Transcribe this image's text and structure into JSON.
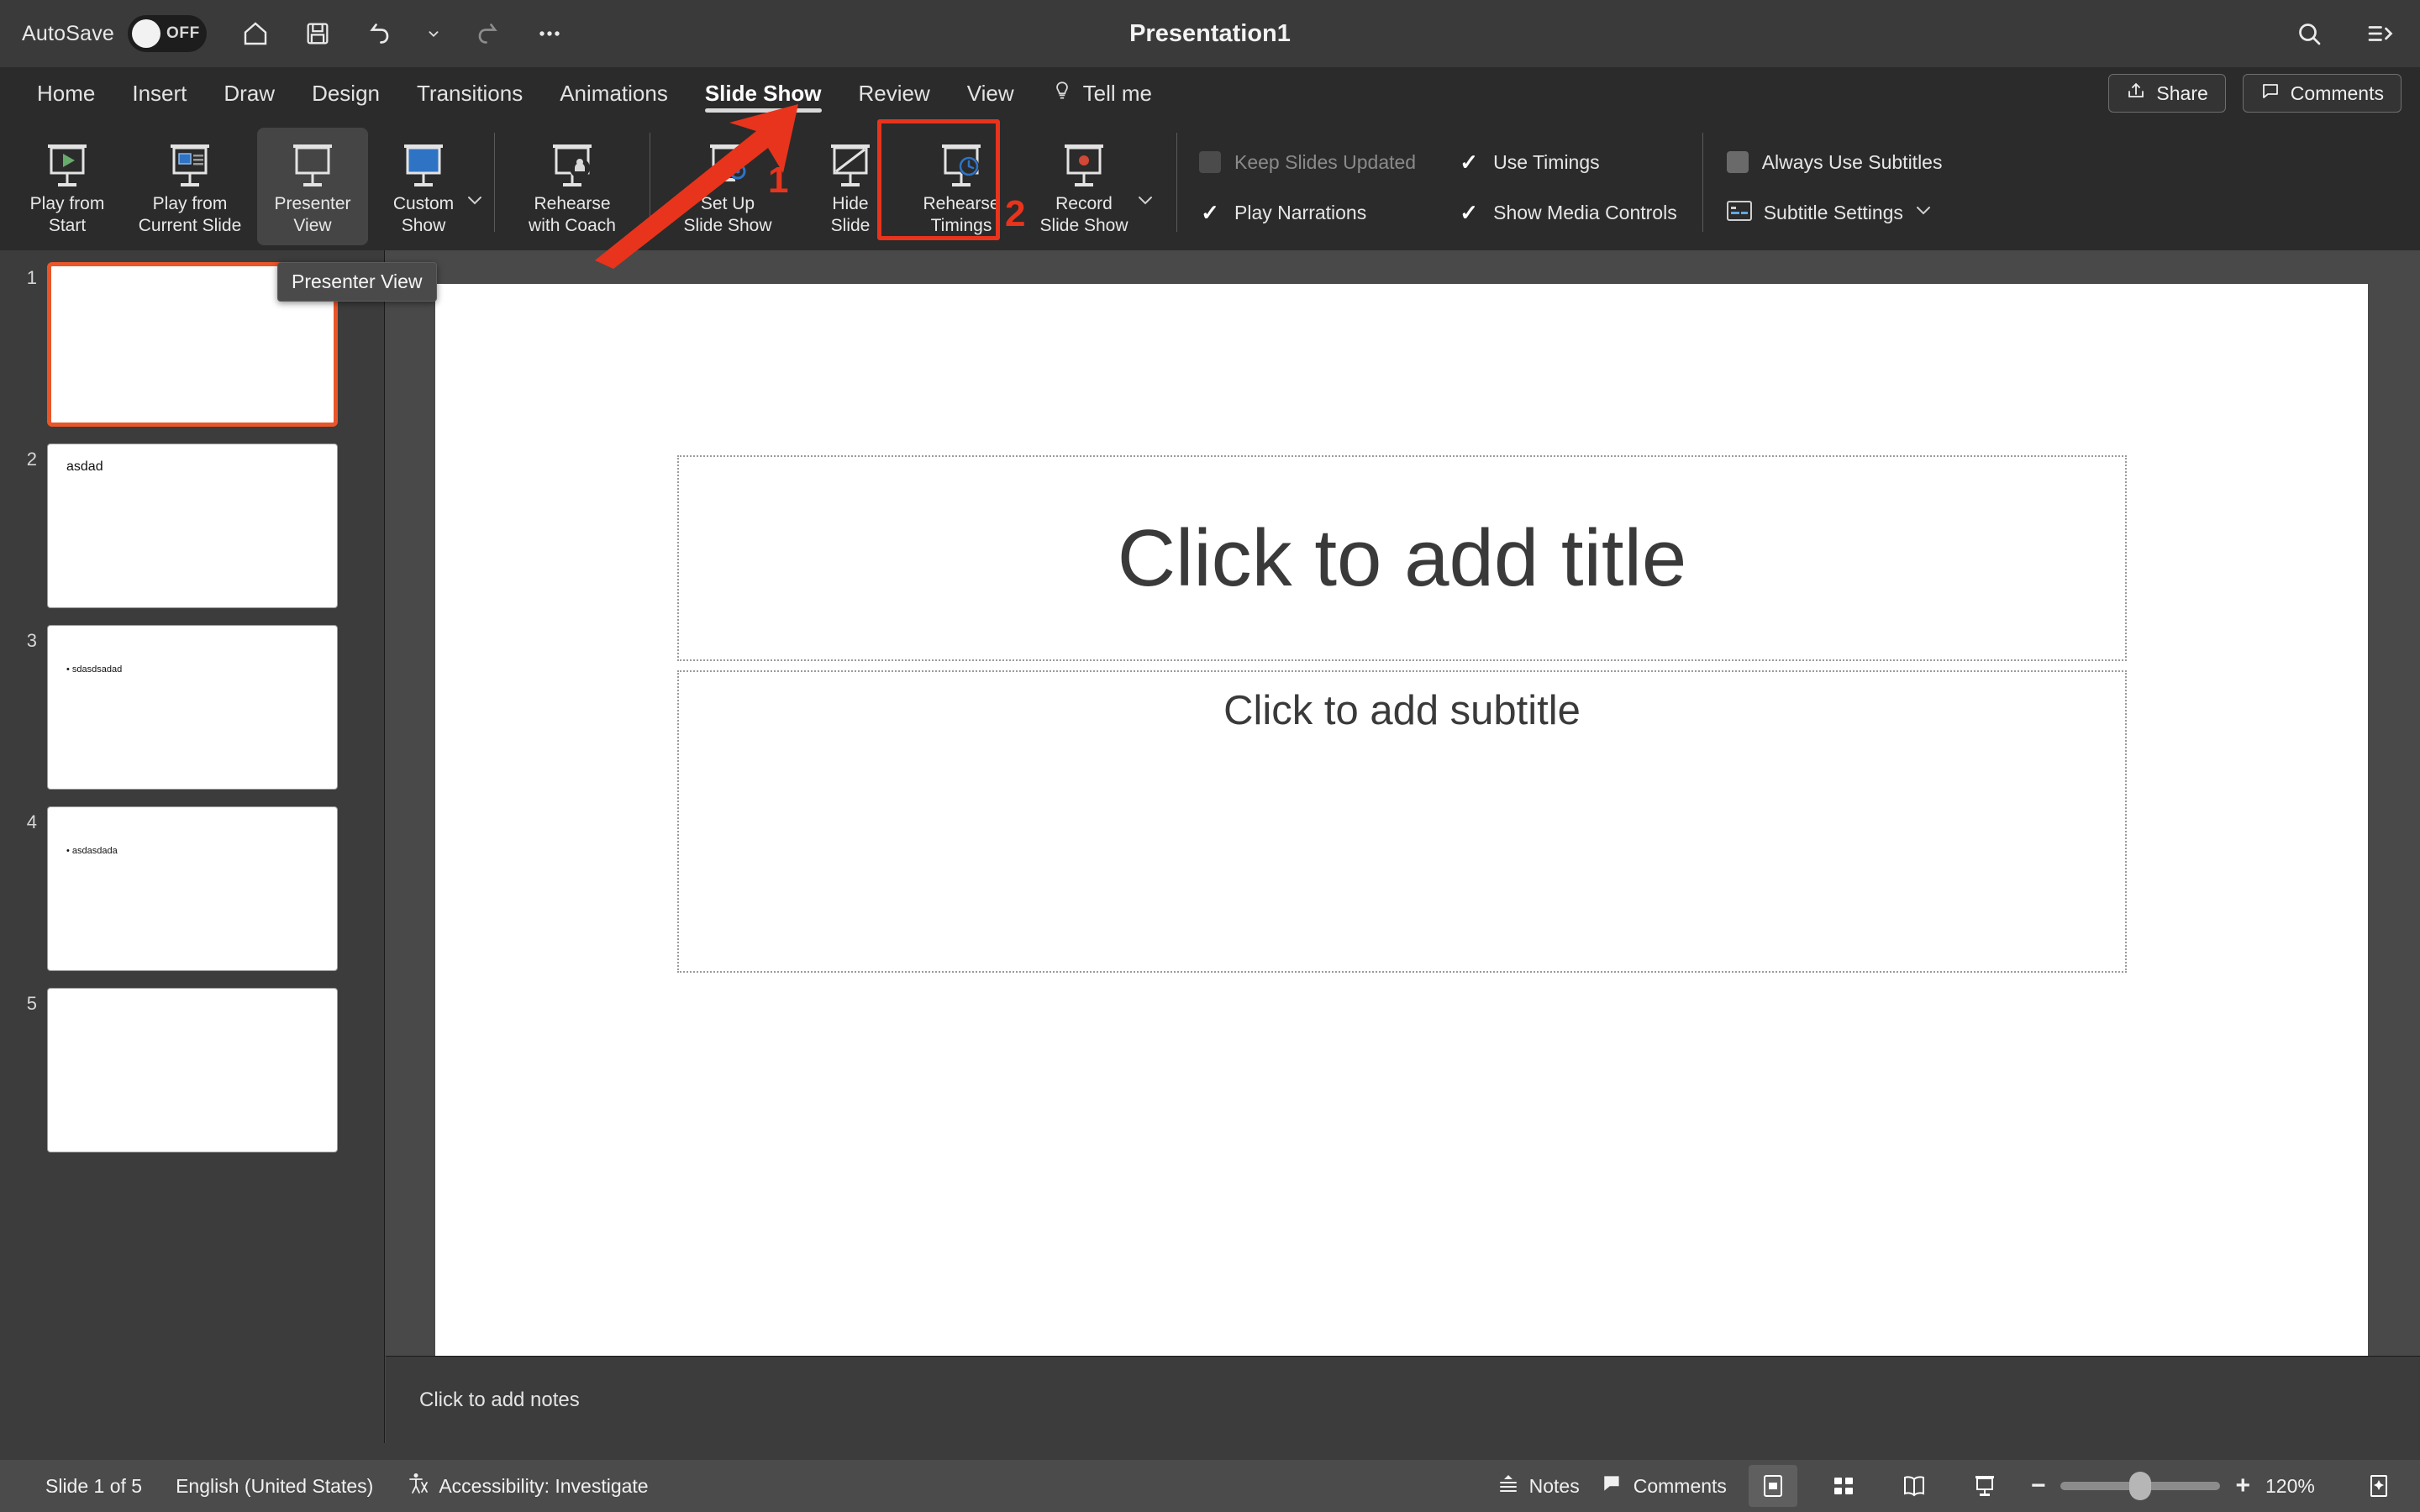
{
  "titlebar": {
    "autosave_label": "AutoSave",
    "autosave_state": "OFF",
    "document_title": "Presentation1",
    "icons": [
      "home-icon",
      "save-icon",
      "undo-icon",
      "undo-dropdown-icon",
      "redo-icon",
      "more-options-icon"
    ],
    "right_icons": [
      "search-icon",
      "ribbon-display-icon"
    ]
  },
  "tabs": [
    {
      "label": "Home",
      "active": false
    },
    {
      "label": "Insert",
      "active": false
    },
    {
      "label": "Draw",
      "active": false
    },
    {
      "label": "Design",
      "active": false
    },
    {
      "label": "Transitions",
      "active": false
    },
    {
      "label": "Animations",
      "active": false
    },
    {
      "label": "Slide Show",
      "active": true
    },
    {
      "label": "Review",
      "active": false
    },
    {
      "label": "View",
      "active": false
    }
  ],
  "tellme": {
    "label": "Tell me",
    "icon": "lightbulb-icon"
  },
  "tabbar_right": {
    "share_label": "Share",
    "share_icon": "share-icon",
    "comments_label": "Comments",
    "comments_icon": "comment-icon"
  },
  "ribbon": {
    "buttons": [
      {
        "label": "Play from\nStart",
        "line1": "Play from",
        "line2": "Start",
        "icon": "play-from-start-icon"
      },
      {
        "label": "Play from\nCurrent Slide",
        "line1": "Play from",
        "line2": "Current Slide",
        "icon": "play-from-current-slide-icon"
      },
      {
        "label": "Presenter\nView",
        "line1": "Presenter",
        "line2": "View",
        "icon": "presenter-view-icon",
        "hovered": true
      },
      {
        "label": "Custom\nShow",
        "line1": "Custom",
        "line2": "Show",
        "icon": "custom-show-icon",
        "has_dropdown": true
      },
      {
        "label": "Rehearse\nwith Coach",
        "line1": "Rehearse",
        "line2": "with Coach",
        "icon": "rehearse-with-coach-icon"
      },
      {
        "label": "Set Up\nSlide Show",
        "line1": "Set Up",
        "line2": "Slide Show",
        "icon": "set-up-slide-show-icon"
      },
      {
        "label": "Hide\nSlide",
        "line1": "Hide",
        "line2": "Slide",
        "icon": "hide-slide-icon"
      },
      {
        "label": "Rehearse\nTimings",
        "line1": "Rehearse",
        "line2": "Timings",
        "icon": "rehearse-timings-icon"
      },
      {
        "label": "Record\nSlide Show",
        "line1": "Record",
        "line2": "Slide Show",
        "icon": "record-slide-show-icon",
        "has_dropdown": true
      }
    ],
    "checks": [
      {
        "label": "Keep Slides Updated",
        "state": "unchecked",
        "disabled": true
      },
      {
        "label": "Play Narrations",
        "state": "checked",
        "disabled": false
      },
      {
        "label": "Use Timings",
        "state": "checked",
        "disabled": false
      },
      {
        "label": "Show Media Controls",
        "state": "checked",
        "disabled": false
      },
      {
        "label": "Always Use Subtitles",
        "state": "unchecked",
        "disabled": false
      }
    ],
    "subtitle_settings": {
      "label": "Subtitle Settings",
      "icon": "subtitle-settings-icon",
      "chevron": "chevron-down-icon"
    }
  },
  "thumbnails": [
    {
      "number": "1",
      "title": "",
      "bullet": "",
      "selected": true
    },
    {
      "number": "2",
      "title": "asdad",
      "bullet": "",
      "selected": false
    },
    {
      "number": "3",
      "title": "",
      "bullet": "sdasdsadad",
      "selected": false
    },
    {
      "number": "4",
      "title": "",
      "bullet": "asdasdada",
      "selected": false
    },
    {
      "number": "5",
      "title": "",
      "bullet": "",
      "selected": false
    }
  ],
  "slide": {
    "title_placeholder": "Click to add title",
    "subtitle_placeholder": "Click to add subtitle"
  },
  "notes": {
    "placeholder": "Click to add notes"
  },
  "status": {
    "slide_counter": "Slide 1 of 5",
    "language": "English (United States)",
    "accessibility": "Accessibility: Investigate",
    "accessibility_icon": "accessibility-icon",
    "notes_label": "Notes",
    "notes_icon": "notes-icon",
    "comments_label": "Comments",
    "comments_icon": "comment-icon",
    "views": [
      "normal-view-icon",
      "slide-sorter-icon",
      "reading-view-icon",
      "slide-show-view-icon"
    ],
    "active_view": "normal-view-icon",
    "zoom_out_icon": "minus-icon",
    "zoom_in_icon": "plus-icon",
    "zoom_value": "120%",
    "fit_slide_icon": "fit-slide-icon"
  },
  "annotations": {
    "step1": "1",
    "step2": "2",
    "tooltip": "Presenter View"
  },
  "colors": {
    "accent_red": "#e8341c",
    "selection_orange": "#e8562a",
    "ribbon_bg": "#2b2b2b",
    "titlebar_bg": "#3a3a3a",
    "status_bg": "#4b4b4b"
  }
}
